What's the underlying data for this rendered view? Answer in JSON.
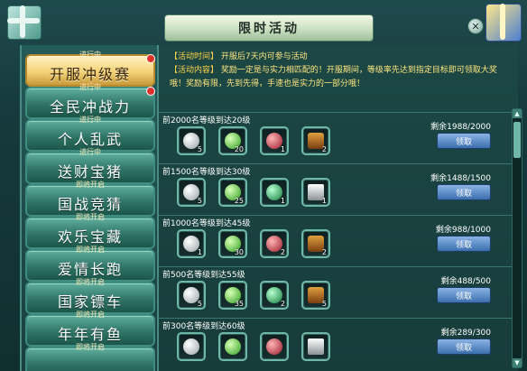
{
  "title": "限时活动",
  "close_icon": "close-icon",
  "info": {
    "time_key": "【活动时间】",
    "time_val": "开服后7天内可参与活动",
    "content_key": "【活动内容】",
    "content_val": "奖励一定是与实力相匹配的！开服期间，等级率先达到指定目标即可领取大奖哦！奖励有限，先到先得，手速也是实力的一部分哦！"
  },
  "tabs": [
    {
      "status": "进行中",
      "label": "开服冲级赛",
      "active": true,
      "dot": true
    },
    {
      "status": "进行中",
      "label": "全民冲战力",
      "active": false,
      "dot": true
    },
    {
      "status": "进行中",
      "label": "个人乱武",
      "active": false,
      "dot": false
    },
    {
      "status": "进行中",
      "label": "送财宝猪",
      "active": false,
      "dot": false
    },
    {
      "status": "即将开启",
      "label": "国战竞猜",
      "active": false,
      "dot": false
    },
    {
      "status": "即将开启",
      "label": "欢乐宝藏",
      "active": false,
      "dot": false
    },
    {
      "status": "即将开启",
      "label": "爱情长跑",
      "active": false,
      "dot": false
    },
    {
      "status": "即将开启",
      "label": "国家镖车",
      "active": false,
      "dot": false
    },
    {
      "status": "即将开启",
      "label": "年年有鱼",
      "active": false,
      "dot": false
    },
    {
      "status": "即将开启",
      "label": "",
      "active": false,
      "dot": false
    }
  ],
  "rewards": [
    {
      "condition": "前2000名等级到达20级",
      "remain": "剩余1988/2000",
      "button": "领取",
      "items": [
        {
          "icon": "silver-ingot-icon",
          "count": "5"
        },
        {
          "icon": "green-gem-icon",
          "count": "20"
        },
        {
          "icon": "red-gem-icon",
          "count": "1"
        },
        {
          "icon": "chest-icon",
          "count": "2"
        }
      ]
    },
    {
      "condition": "前1500名等级到达30级",
      "remain": "剩余1488/1500",
      "button": "领取",
      "items": [
        {
          "icon": "silver-ingot-icon",
          "count": "5"
        },
        {
          "icon": "green-gem-icon",
          "count": "25"
        },
        {
          "icon": "green-orb-icon",
          "count": "1"
        },
        {
          "icon": "silver-bar-icon",
          "count": "1"
        }
      ]
    },
    {
      "condition": "前1000名等级到达45级",
      "remain": "剩余988/1000",
      "button": "领取",
      "items": [
        {
          "icon": "silver-ingot-icon",
          "count": "1"
        },
        {
          "icon": "green-gem-icon",
          "count": "30"
        },
        {
          "icon": "red-gem-icon",
          "count": "2"
        },
        {
          "icon": "chest-icon",
          "count": "2"
        }
      ]
    },
    {
      "condition": "前500名等级到达55级",
      "remain": "剩余488/500",
      "button": "领取",
      "items": [
        {
          "icon": "silver-ingot-icon",
          "count": "5"
        },
        {
          "icon": "green-gem-icon",
          "count": "35"
        },
        {
          "icon": "green-orb-icon",
          "count": "2"
        },
        {
          "icon": "chest-icon",
          "count": "5"
        }
      ]
    },
    {
      "condition": "前300名等级到达60级",
      "remain": "剩余289/300",
      "button": "领取",
      "items": [
        {
          "icon": "silver-ingot-icon",
          "count": ""
        },
        {
          "icon": "green-gem-icon",
          "count": ""
        },
        {
          "icon": "red-gem-icon",
          "count": ""
        },
        {
          "icon": "silver-bar-icon",
          "count": ""
        }
      ]
    }
  ],
  "colors": {
    "accent_gold": "#ffd24a",
    "panel_teal": "#1b4744",
    "button_blue": "#3c6fae"
  }
}
